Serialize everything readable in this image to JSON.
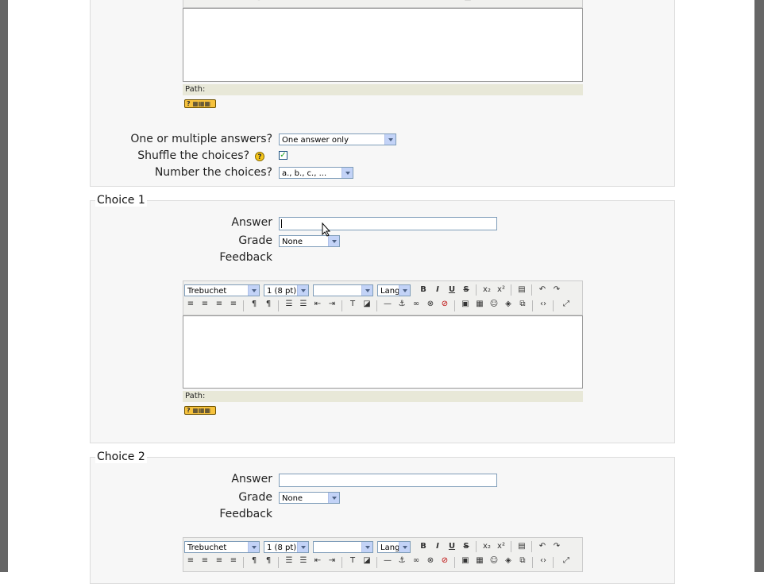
{
  "question_settings": {
    "one_or_multiple_label": "One or multiple answers?",
    "one_or_multiple_value": "One answer only",
    "shuffle_label": "Shuffle the choices?",
    "shuffle_checked": true,
    "number_label": "Number the choices?",
    "number_value": "a., b., c., ..."
  },
  "editor": {
    "path_label": "Path:",
    "font_value": "Trebuchet",
    "size_value": "1 (8 pt)",
    "format_value": "",
    "lang_value": "Lang"
  },
  "choices": [
    {
      "legend": "Choice 1",
      "answer_label": "Answer",
      "answer_value": "",
      "grade_label": "Grade",
      "grade_value": "None",
      "feedback_label": "Feedback"
    },
    {
      "legend": "Choice 2",
      "answer_label": "Answer",
      "answer_value": "",
      "grade_label": "Grade",
      "grade_value": "None",
      "feedback_label": "Feedback"
    }
  ],
  "icons": {
    "help": "help-icon",
    "bold": "B",
    "italic": "I",
    "underline": "U",
    "strike": "S"
  }
}
